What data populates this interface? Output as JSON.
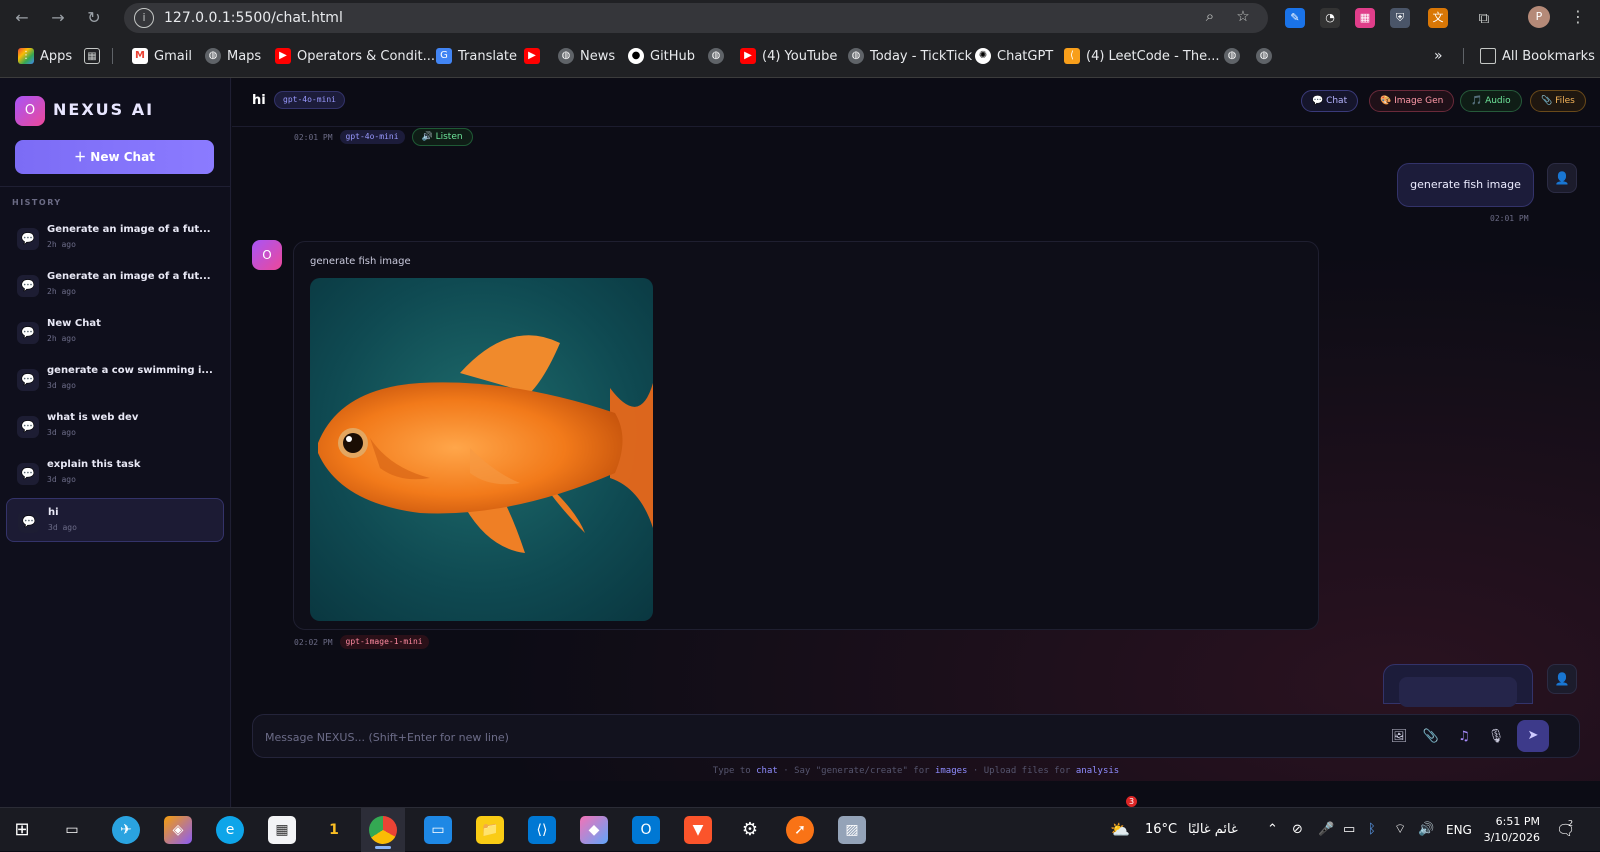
{
  "browser": {
    "url": "127.0.0.1:5500/chat.html",
    "profile_initial": "P",
    "bookmarks": [
      {
        "label": "Apps",
        "icon": "apps-grid-icon"
      },
      {
        "label": "",
        "icon": "grid-icon"
      },
      {
        "label": "Gmail",
        "icon": "gmail-icon"
      },
      {
        "label": "Maps",
        "icon": "globe-icon"
      },
      {
        "label": "Operators & Condit...",
        "icon": "youtube-icon"
      },
      {
        "label": "Translate",
        "icon": "translate-icon"
      },
      {
        "label": "",
        "icon": "youtube-icon"
      },
      {
        "label": "News",
        "icon": "globe-icon"
      },
      {
        "label": "GitHub",
        "icon": "github-icon"
      },
      {
        "label": "",
        "icon": "globe-icon"
      },
      {
        "label": "(4) YouTube",
        "icon": "youtube-icon"
      },
      {
        "label": "Today - TickTick",
        "icon": "globe-icon"
      },
      {
        "label": "ChatGPT",
        "icon": "chatgpt-icon"
      },
      {
        "label": "(4) LeetCode - The...",
        "icon": "leetcode-icon"
      },
      {
        "label": "",
        "icon": "globe-icon"
      },
      {
        "label": "",
        "icon": "globe-icon"
      }
    ],
    "all_bookmarks": "All Bookmarks",
    "more": "»"
  },
  "sidebar": {
    "logo_glyph": "O",
    "brand": "NEXUS AI",
    "new_chat": "＋  New Chat",
    "history_label": "HISTORY",
    "history": [
      {
        "title": "Generate an image of a fut...",
        "time": "2h ago"
      },
      {
        "title": "Generate an image of a fut...",
        "time": "2h ago"
      },
      {
        "title": "New Chat",
        "time": "2h ago"
      },
      {
        "title": "generate a cow swimming i...",
        "time": "3d ago"
      },
      {
        "title": "what is web dev",
        "time": "3d ago"
      },
      {
        "title": "explain this task",
        "time": "3d ago"
      },
      {
        "title": "hi",
        "time": "3d ago",
        "active": true
      }
    ]
  },
  "header": {
    "title": "hi",
    "model": "gpt-4o-mini",
    "modes": [
      {
        "label": "💬 Chat",
        "key": "chat"
      },
      {
        "label": "🎨 Image Gen",
        "key": "img"
      },
      {
        "label": "🎵 Audio",
        "key": "aud"
      },
      {
        "label": "📎 Files",
        "key": "fil"
      }
    ]
  },
  "messages": {
    "prev_meta": {
      "time": "02:01 PM",
      "model": "gpt-4o-mini",
      "listen": "🔊 Listen"
    },
    "user1": {
      "text": "generate fish image",
      "time": "02:01 PM"
    },
    "ai1": {
      "caption": "generate fish image",
      "image_alt": "goldfish",
      "time": "02:02 PM",
      "model": "gpt-image-1-mini"
    }
  },
  "composer": {
    "placeholder": "Message NEXUS... (Shift+Enter for new line)",
    "tools": [
      "image-icon",
      "paperclip-icon",
      "music-icon",
      "mic-icon"
    ],
    "send_icon": "send-icon"
  },
  "hint": {
    "p1": "Type to ",
    "chat": "chat",
    "p2": " · Say \"generate/create\" for ",
    "images": "images",
    "p3": " · Upload files for ",
    "analysis": "analysis"
  },
  "taskbar": {
    "weather_temp": "16°C",
    "weather_text": "غائم غالبًا",
    "weather_badge": "3",
    "language": "ENG",
    "time": "6:51 PM",
    "date": "3/10/2026",
    "notifications": "2"
  },
  "colors": {
    "accent": "#7c6cf5",
    "background": "#0c0c15",
    "brand_gradient_start": "#a855f7",
    "brand_gradient_end": "#ec4899"
  }
}
